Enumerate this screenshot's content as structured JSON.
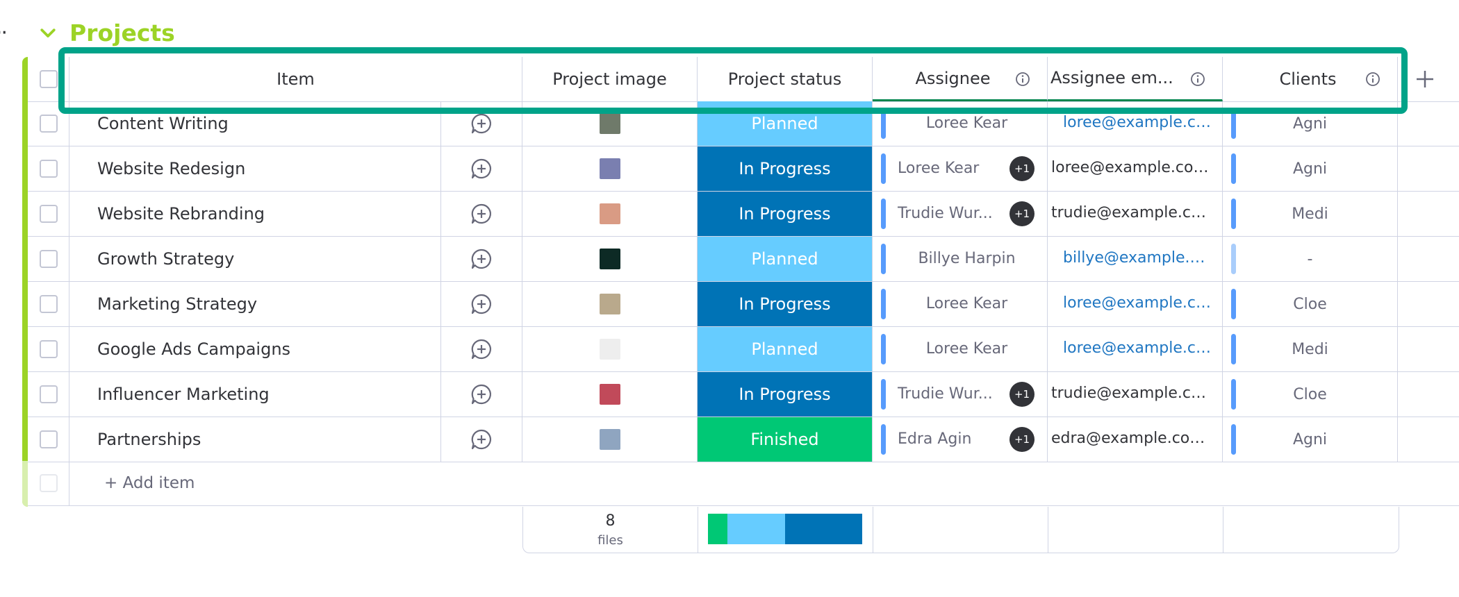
{
  "colors": {
    "group_accent": "#9cd326",
    "planned": "#66ccff",
    "in_progress": "#0073b6",
    "finished": "#00c875",
    "highlight": "#00a389",
    "link": "#1f76c2"
  },
  "group": {
    "title": "Projects",
    "toggle_icon": "chevron-down-icon",
    "menu_icon": "more-dots-icon"
  },
  "columns": {
    "item": "Item",
    "image": "Project image",
    "status": "Project status",
    "assignee": "Assignee",
    "email": "Assignee em...",
    "clients": "Clients",
    "add_icon": "plus-icon",
    "info_icon": "info-icon"
  },
  "rows": [
    {
      "item": "Content Writing",
      "status": "Planned",
      "status_color": "#66ccff",
      "assignee": "Loree Kear",
      "extra": "",
      "email": "loree@example.co...",
      "email_link": true,
      "client": "Agni",
      "thumb": "#6f7a6a"
    },
    {
      "item": "Website Redesign",
      "status": "In Progress",
      "status_color": "#0073b6",
      "assignee": "Loree Kear",
      "extra": "+1",
      "email": "loree@example.com, ...",
      "email_link": false,
      "client": "Agni",
      "thumb": "#7a7fb0"
    },
    {
      "item": "Website Rebranding",
      "status": "In Progress",
      "status_color": "#0073b6",
      "assignee": "Trudie Wur...",
      "extra": "+1",
      "email": "trudie@example.com...",
      "email_link": false,
      "client": "Medi",
      "thumb": "#d99b84"
    },
    {
      "item": "Growth Strategy",
      "status": "Planned",
      "status_color": "#66ccff",
      "assignee": "Billye Harpin",
      "extra": "",
      "email": "billye@example.co...",
      "email_link": true,
      "client": "-",
      "thumb": "#0d2a25"
    },
    {
      "item": "Marketing Strategy",
      "status": "In Progress",
      "status_color": "#0073b6",
      "assignee": "Loree Kear",
      "extra": "",
      "email": "loree@example.co...",
      "email_link": true,
      "client": "Cloe",
      "thumb": "#b9a98c"
    },
    {
      "item": "Google Ads Campaigns",
      "status": "Planned",
      "status_color": "#66ccff",
      "assignee": "Loree Kear",
      "extra": "",
      "email": "loree@example.co...",
      "email_link": true,
      "client": "Medi",
      "thumb": "#eeeeee"
    },
    {
      "item": "Influencer Marketing",
      "status": "In Progress",
      "status_color": "#0073b6",
      "assignee": "Trudie Wur...",
      "extra": "+1",
      "email": "trudie@example.com...",
      "email_link": false,
      "client": "Cloe",
      "thumb": "#c14a5a"
    },
    {
      "item": "Partnerships",
      "status": "Finished",
      "status_color": "#00c875",
      "assignee": "Edra Agin",
      "extra": "+1",
      "email": "edra@example.com, r...",
      "email_link": false,
      "client": "Agni",
      "thumb": "#8fa5c0"
    }
  ],
  "add_item": "+ Add item",
  "summary": {
    "files_count": "8",
    "files_label": "files",
    "status_distribution": [
      {
        "status": "Finished",
        "count": 1,
        "color": "#00c875"
      },
      {
        "status": "Planned",
        "count": 3,
        "color": "#66ccff"
      },
      {
        "status": "In Progress",
        "count": 4,
        "color": "#0073b6"
      }
    ]
  }
}
